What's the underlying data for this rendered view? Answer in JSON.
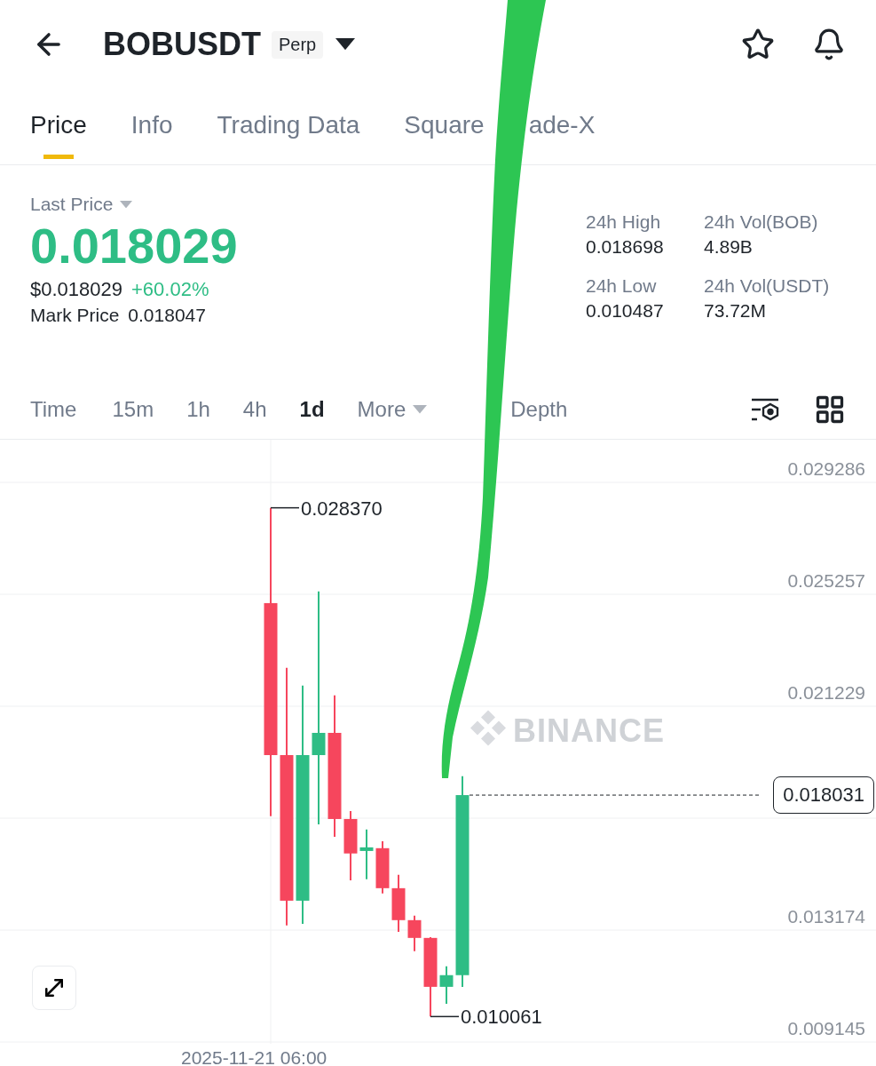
{
  "header": {
    "symbol": "BOBUSDT",
    "badge": "Perp"
  },
  "tabs": [
    {
      "label": "Price",
      "selected": true
    },
    {
      "label": "Info",
      "selected": false
    },
    {
      "label": "Trading Data",
      "selected": false
    },
    {
      "label": "Square",
      "selected": false
    },
    {
      "label": "ade-X",
      "selected": false
    }
  ],
  "price": {
    "label": "Last Price",
    "last": "0.018029",
    "usd": "$0.018029",
    "change": "+60.02%",
    "mark_label": "Mark Price",
    "mark": "0.018047"
  },
  "stats": [
    {
      "label": "24h High",
      "value": "0.018698"
    },
    {
      "label": "24h Vol(BOB)",
      "value": "4.89B"
    },
    {
      "label": "24h Low",
      "value": "0.010487"
    },
    {
      "label": "24h Vol(USDT)",
      "value": "73.72M"
    }
  ],
  "intervals": [
    {
      "label": "Time",
      "kind": "interval",
      "selected": false
    },
    {
      "label": "15m",
      "kind": "interval",
      "selected": false
    },
    {
      "label": "1h",
      "kind": "interval",
      "selected": false
    },
    {
      "label": "4h",
      "kind": "interval",
      "selected": false
    },
    {
      "label": "1d",
      "kind": "interval",
      "selected": true
    },
    {
      "label": "More",
      "kind": "dropdown",
      "selected": false
    },
    {
      "label": "Depth",
      "kind": "interval",
      "selected": false
    }
  ],
  "chart": {
    "watermark": "BINANCE",
    "y_labels": [
      "0.029286",
      "0.025257",
      "0.021229",
      "0.013174",
      "0.009145"
    ],
    "high_label": "0.028370",
    "low_label": "0.010061",
    "last_price_label": "0.018031",
    "time_label": "2025-11-21 06:00"
  }
}
